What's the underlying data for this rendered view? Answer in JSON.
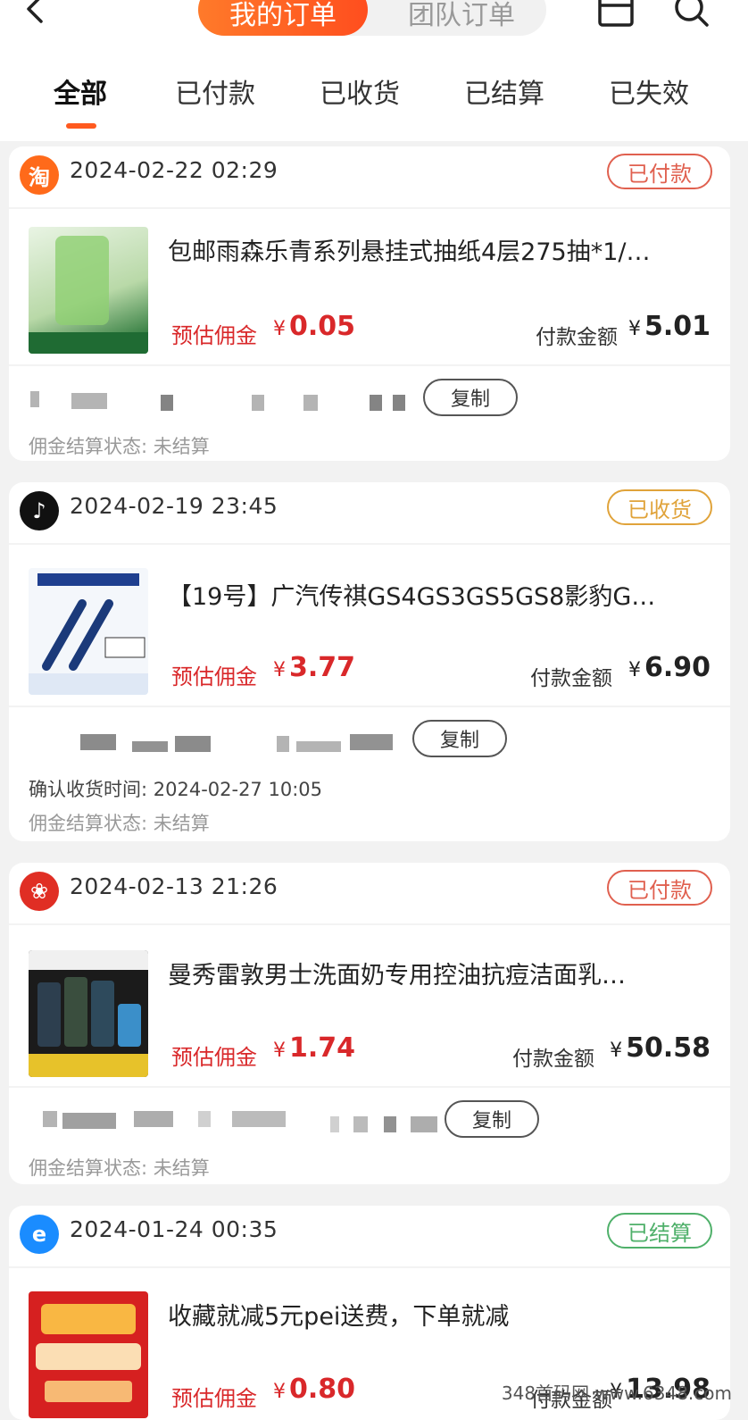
{
  "header": {
    "segment_active": "我的订单",
    "segment_inactive": "团队订单",
    "tabs": [
      "全部",
      "已付款",
      "已收货",
      "已结算",
      "已失效"
    ]
  },
  "labels": {
    "commission": "预估佣金",
    "payment": "付款金额",
    "currency": "¥",
    "copy": "复制",
    "settle_status": "佣金结算状态: 未结算",
    "confirm_receipt": "确认收货时间: 2024-02-27 10:05"
  },
  "orders": [
    {
      "platform_icon": "taobao-icon",
      "platform_glyph": "淘",
      "datetime": "2024-02-22 02:29",
      "status": "已付款",
      "status_color": "#e0604f",
      "title": "包邮雨森乐青系列悬挂式抽纸4层275抽*1/…",
      "commission": "0.05",
      "payment": "5.01"
    },
    {
      "platform_icon": "douyin-icon",
      "platform_glyph": "♪",
      "datetime": "2024-02-19 23:45",
      "status": "已收货",
      "status_color": "#e0a33a",
      "title": "【19号】广汽传祺GS4GS3GS5GS8影豹G…",
      "commission": "3.77",
      "payment": "6.90"
    },
    {
      "platform_icon": "pinduoduo-icon",
      "platform_glyph": "❀",
      "datetime": "2024-02-13 21:26",
      "status": "已付款",
      "status_color": "#e0604f",
      "title": "曼秀雷敦男士洗面奶专用控油抗痘洁面乳…",
      "commission": "1.74",
      "payment": "50.58"
    },
    {
      "platform_icon": "eleme-icon",
      "platform_glyph": "e",
      "datetime": "2024-01-24 00:35",
      "status": "已结算",
      "status_color": "#4fb06a",
      "title": "收藏就减5元pei送费，下单就减",
      "commission": "0.80",
      "payment": "13.98"
    }
  ],
  "watermark": "348首码网 www.6348.com"
}
